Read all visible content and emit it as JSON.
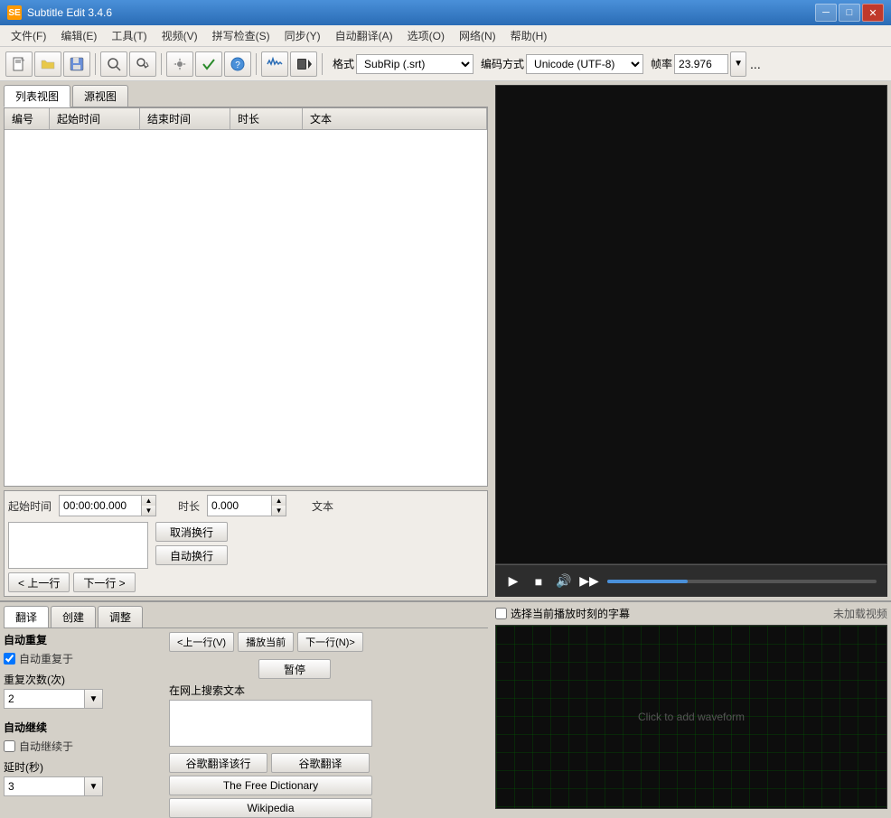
{
  "titlebar": {
    "icon": "SE",
    "title": "Subtitle Edit 3.4.6",
    "controls": {
      "minimize": "─",
      "maximize": "□",
      "close": "✕"
    }
  },
  "menubar": {
    "items": [
      "文件(F)",
      "编辑(E)",
      "工具(T)",
      "视频(V)",
      "拼写检查(S)",
      "同步(Y)",
      "自动翻译(A)",
      "选项(O)",
      "网络(N)",
      "帮助(H)"
    ]
  },
  "toolbar": {
    "format_label": "格式",
    "format_value": "SubRip (.srt)",
    "encoding_label": "编码方式",
    "encoding_value": "Unicode (UTF-8)",
    "framerate_label": "帧率",
    "framerate_value": "23.976",
    "dots": "..."
  },
  "subtitle_table": {
    "tabs": [
      "列表视图",
      "源视图"
    ],
    "active_tab": 0,
    "columns": [
      "编号",
      "起始时间",
      "结束时间",
      "时长",
      "文本"
    ],
    "rows": []
  },
  "edit_panel": {
    "start_time_label": "起始时间",
    "start_time_value": "00:00:00.000",
    "duration_label": "时长",
    "duration_value": "0.000",
    "text_label": "文本",
    "cancel_row_btn": "取消换行",
    "auto_row_btn": "自动换行",
    "prev_btn": "< 上一行",
    "next_btn": "下一行 >"
  },
  "bottom_panel": {
    "tabs": [
      "翻译",
      "创建",
      "调整"
    ],
    "active_tab": 0,
    "auto_repeat": {
      "label": "自动重复",
      "checkbox_label": "自动重复于",
      "checked": true
    },
    "repeat_count": {
      "label": "重复次数(次)",
      "value": "2"
    },
    "auto_continue": {
      "label": "自动继续",
      "checkbox_label": "自动继续于",
      "checked": false
    },
    "delay": {
      "label": "延时(秒)",
      "value": "3"
    },
    "navigation": {
      "prev_btn": "<上一行(V)",
      "play_current_btn": "播放当前",
      "next_btn": "下一行(N)>",
      "pause_btn": "暂停"
    },
    "search_label": "在网上搜索文本",
    "google_translate_row_btn": "谷歌翻译该行",
    "google_translate_btn": "谷歌翻译",
    "free_dictionary_btn": "The Free Dictionary",
    "wikipedia_btn": "Wikipedia",
    "select_current_label": "选择当前播放时刻的字幕",
    "no_video_label": "未加载视频",
    "waveform_text": "Click to add waveform"
  }
}
